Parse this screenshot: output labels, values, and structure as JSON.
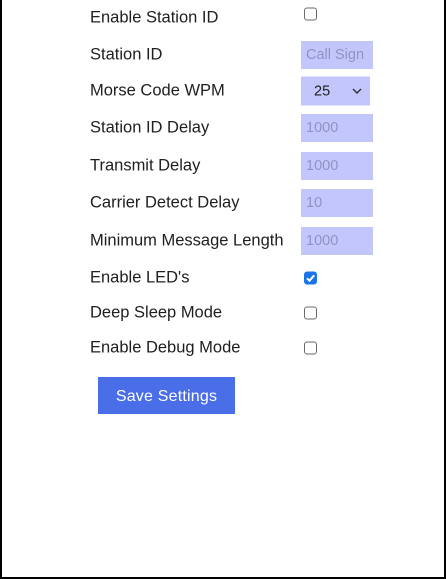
{
  "settings": {
    "enable_station_id": {
      "label": "Enable Station ID",
      "checked": false
    },
    "station_id": {
      "label": "Station ID",
      "value": "",
      "placeholder": "Call Sign"
    },
    "morse_wpm": {
      "label": "Morse Code WPM",
      "selected": "25"
    },
    "station_id_delay": {
      "label": "Station ID Delay",
      "value": "1000"
    },
    "transmit_delay": {
      "label": "Transmit Delay",
      "value": "1000"
    },
    "carrier_detect_delay": {
      "label": "Carrier Detect Delay",
      "value": "10"
    },
    "min_message_length": {
      "label": "Minimum Message Length",
      "value": "1000"
    },
    "enable_leds": {
      "label": "Enable LED's",
      "checked": true
    },
    "deep_sleep": {
      "label": "Deep Sleep Mode",
      "checked": false
    },
    "debug_mode": {
      "label": "Enable Debug Mode",
      "checked": false
    }
  },
  "actions": {
    "save_label": "Save Settings"
  },
  "colors": {
    "input_bg": "#c2c6fb",
    "button_bg": "#4a6ee8",
    "checkbox_checked": "#1a73e8"
  }
}
